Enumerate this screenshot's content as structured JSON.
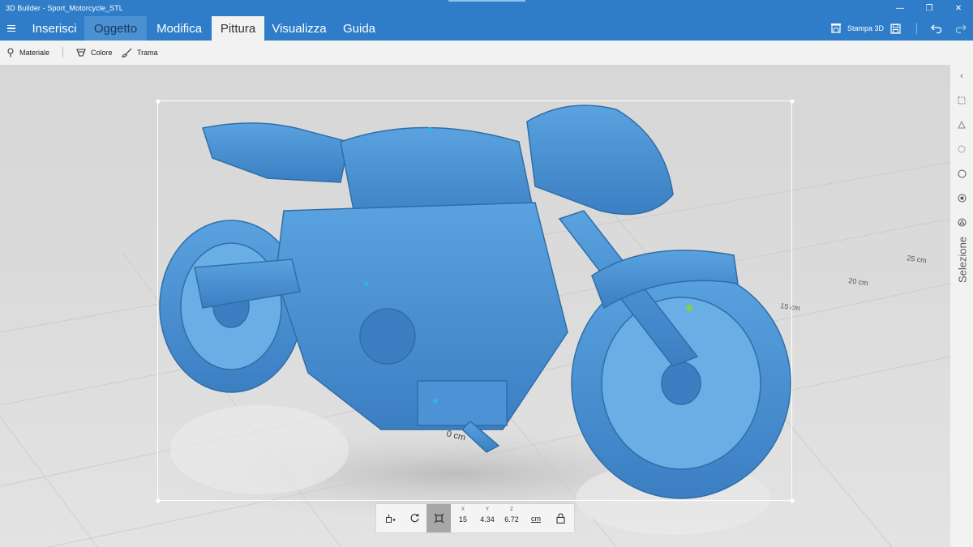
{
  "window": {
    "title": "3D Builder - Sport_Motorcycle_STL",
    "controls": {
      "minimize": "—",
      "restore": "❐",
      "close": "✕"
    }
  },
  "ribbon": {
    "tabs": [
      {
        "label": "Inserisci",
        "state": "normal"
      },
      {
        "label": "Oggetto",
        "state": "hover"
      },
      {
        "label": "Modifica",
        "state": "normal"
      },
      {
        "label": "Pittura",
        "state": "active"
      },
      {
        "label": "Visualizza",
        "state": "normal"
      },
      {
        "label": "Guida",
        "state": "normal"
      }
    ],
    "print_label": "Stampa 3D"
  },
  "subtoolbar": {
    "material": "Materiale",
    "color": "Colore",
    "texture": "Trama"
  },
  "viewport": {
    "model_color": "#4a90d3",
    "grid_labels": [
      "0 cm",
      "15 cm",
      "20 cm",
      "25 cm"
    ]
  },
  "right_panel": {
    "label": "Selezione"
  },
  "transform_bar": {
    "x_label": "X",
    "x_value": "15",
    "y_label": "Y",
    "y_value": "4.34",
    "z_label": "Z",
    "z_value": "6.72",
    "unit": "cm"
  },
  "colors": {
    "accent": "#2f7dc8",
    "toolbar_bg": "#f2f2f2",
    "selected_tool": "#a7a7a7"
  }
}
